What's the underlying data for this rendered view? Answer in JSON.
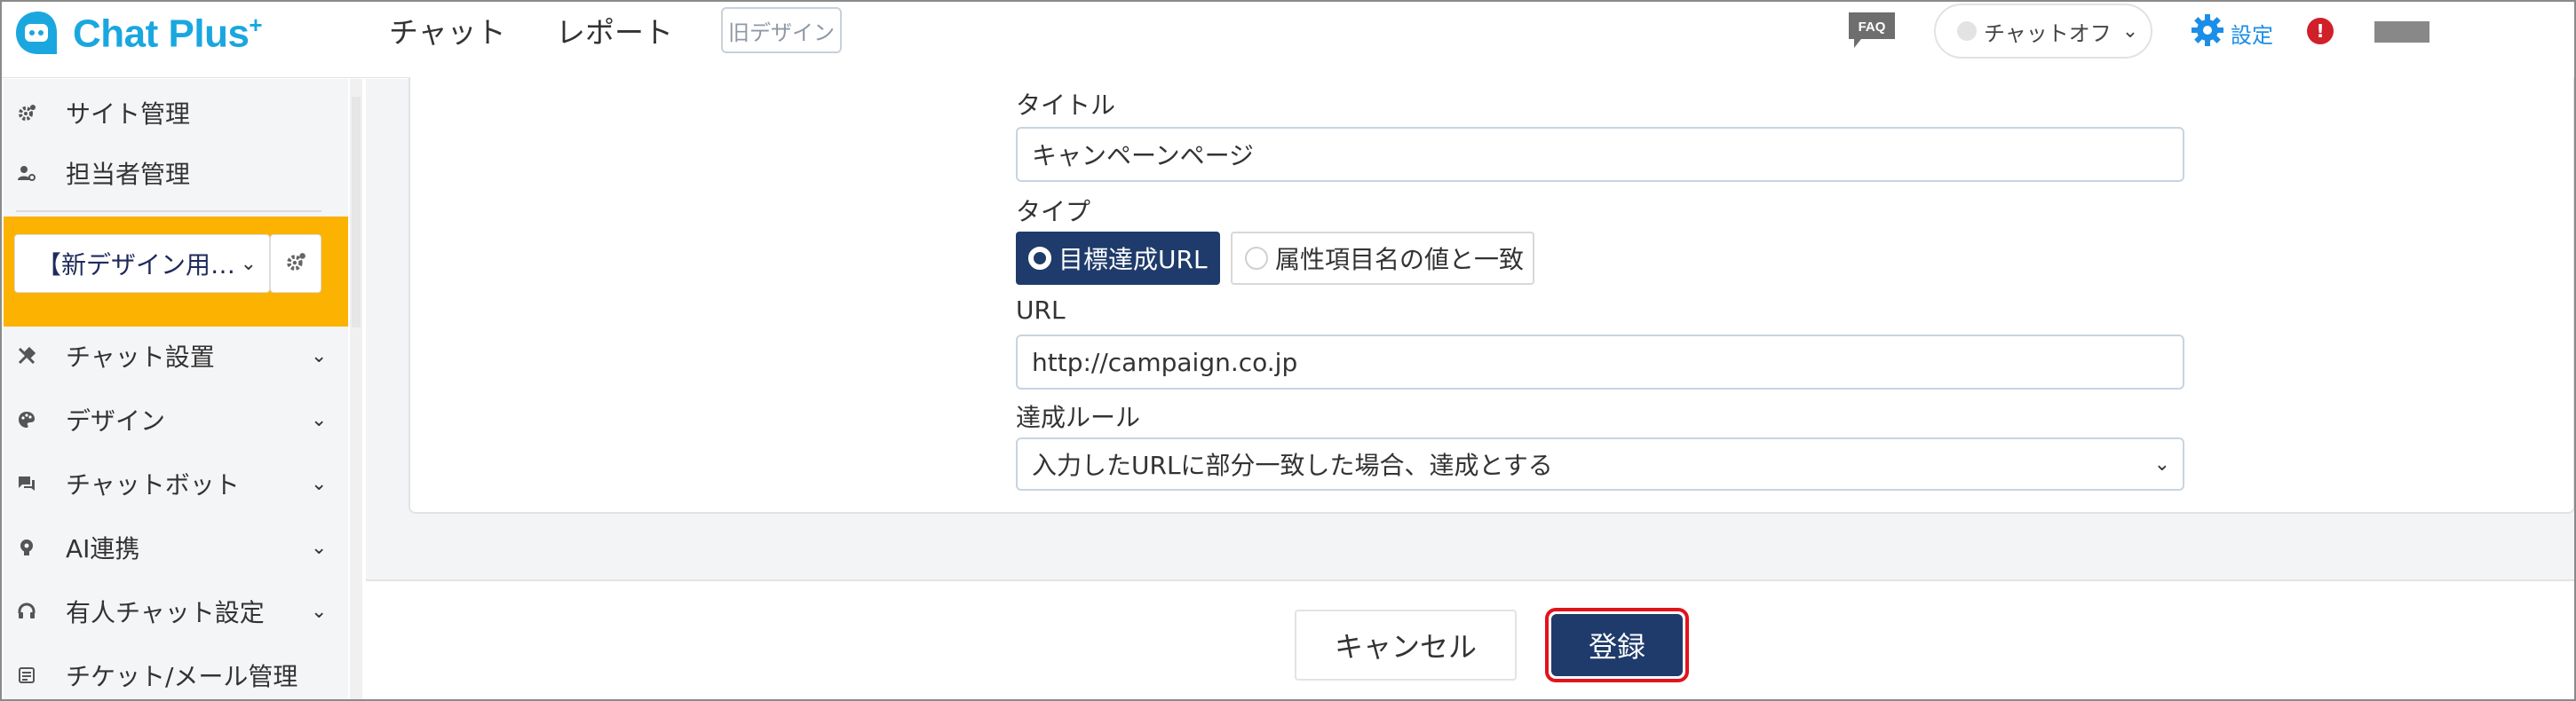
{
  "header": {
    "logo_text": "Chat Plus",
    "logo_plus": "+",
    "nav": [
      "チャット",
      "レポート"
    ],
    "old_design_label": "旧デザイン",
    "faq_label": "FAQ",
    "chat_status": "チャットオフ",
    "settings_label": "設定",
    "alert_symbol": "!",
    "brand_color": "#1aa7df"
  },
  "sidebar": {
    "top_items": [
      {
        "label": "サイト管理",
        "icon": "gear-icon"
      },
      {
        "label": "担当者管理",
        "icon": "user-gear-icon"
      }
    ],
    "site_select": "【新デザイン用…",
    "items": [
      {
        "label": "チャット設置",
        "icon": "tools-icon"
      },
      {
        "label": "デザイン",
        "icon": "palette-icon"
      },
      {
        "label": "チャットボット",
        "icon": "chat-bubbles-icon"
      },
      {
        "label": "AI連携",
        "icon": "ai-bulb-icon"
      },
      {
        "label": "有人チャット設定",
        "icon": "headset-icon"
      },
      {
        "label": "チケット/メール管理",
        "icon": "list-icon"
      }
    ],
    "highlight_color": "#fcb200"
  },
  "form": {
    "title_label": "タイトル",
    "title_value": "キャンペーンページ",
    "type_label": "タイプ",
    "type_options": [
      {
        "label": "目標達成URL",
        "selected": true
      },
      {
        "label": "属性項目名の値と一致",
        "selected": false
      }
    ],
    "url_label": "URL",
    "url_value": "http://campaign.co.jp",
    "rule_label": "達成ルール",
    "rule_value": "入力したURLに部分一致した場合、達成とする"
  },
  "footer": {
    "cancel_label": "キャンセル",
    "register_label": "登録",
    "primary_color": "#1f3b6b",
    "highlight_border_color": "#e2131c"
  }
}
